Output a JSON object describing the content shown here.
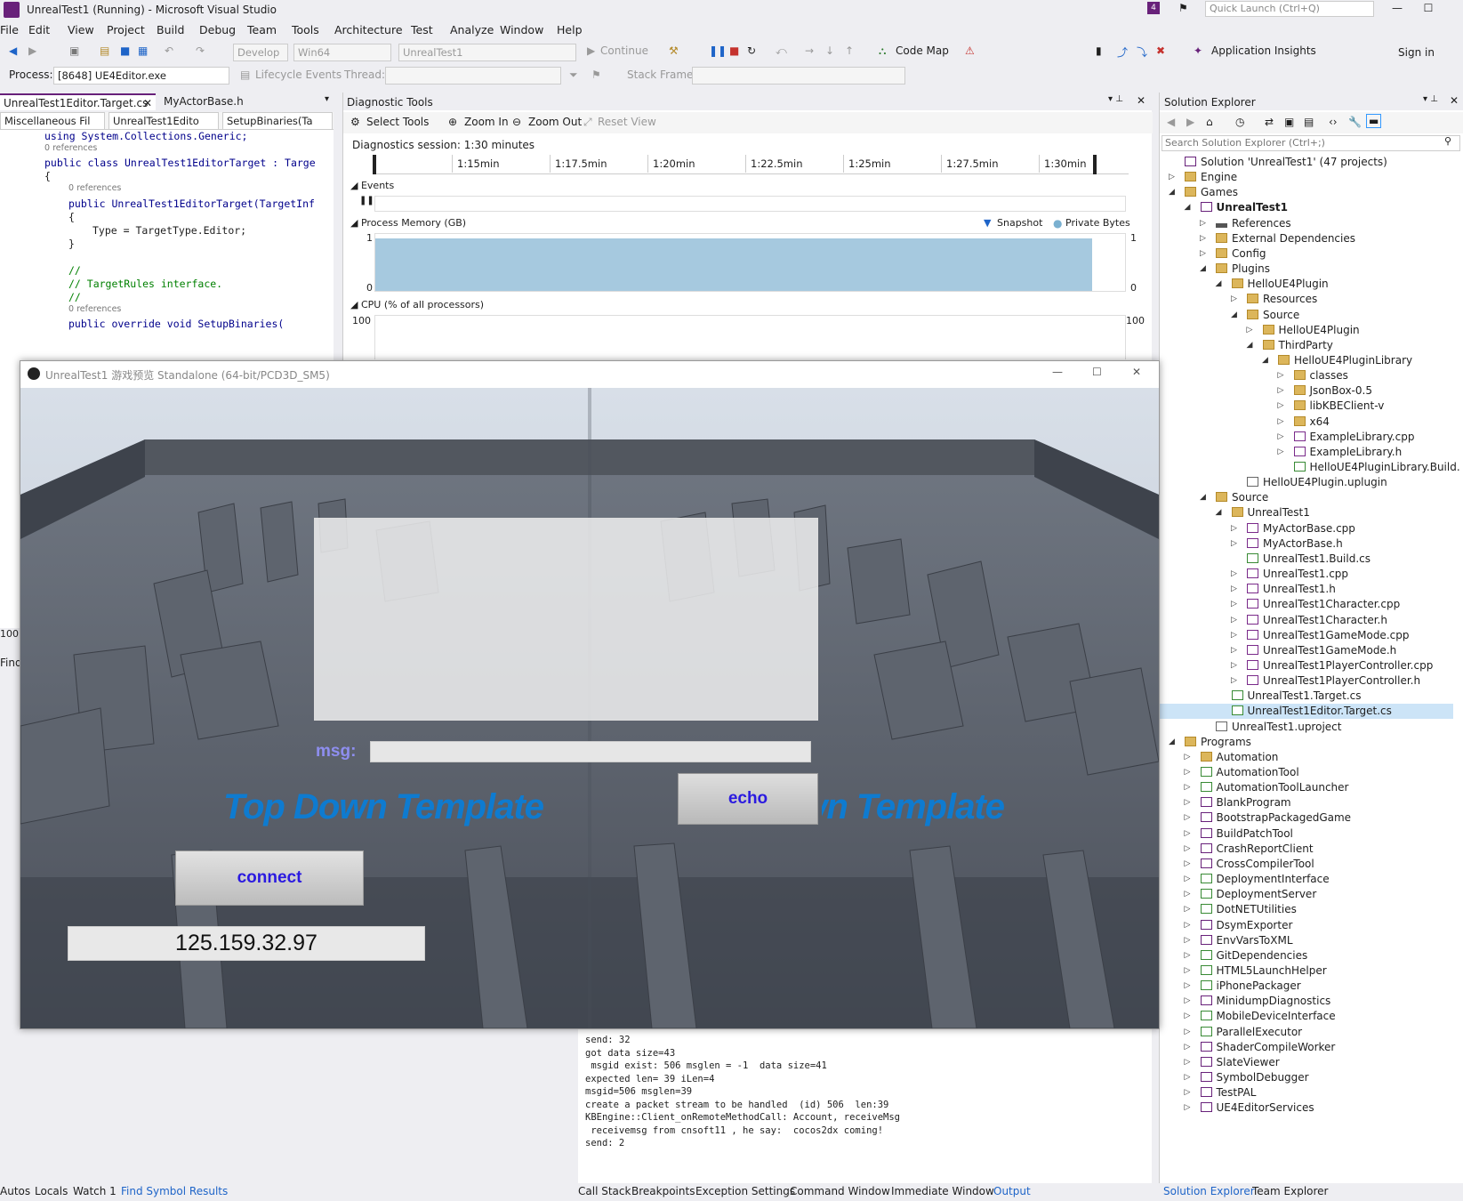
{
  "window": {
    "title": "UnrealTest1 (Running) - Microsoft Visual Studio",
    "quick_launch": "Quick Launch (Ctrl+Q)",
    "notif_count": "4",
    "sign_in": "Sign in"
  },
  "menu": [
    "File",
    "Edit",
    "View",
    "Project",
    "Build",
    "Debug",
    "Team",
    "Tools",
    "Architecture",
    "Test",
    "Analyze",
    "Window",
    "Help"
  ],
  "toolbar": {
    "config": "Develop",
    "platform": "Win64",
    "target": "UnrealTest1",
    "continue": "Continue",
    "code_map": "Code Map",
    "app_insights": "Application Insights"
  },
  "toolbar2": {
    "process_label": "Process:",
    "process_value": "[8648] UE4Editor.exe",
    "lifecycle": "Lifecycle Events",
    "thread_label": "Thread:",
    "stack_frame_label": "Stack Frame:"
  },
  "editor": {
    "tabs": [
      "UnrealTest1Editor.Target.cs",
      "MyActorBase.h"
    ],
    "nav": [
      "Miscellaneous Fil",
      "UnrealTest1Edito",
      "SetupBinaries(Ta"
    ],
    "lines": [
      {
        "indent": 0,
        "text": "using System.Collections.Generic;"
      },
      {
        "indent": 0,
        "text": "0 references",
        "ref": true
      },
      {
        "indent": 0,
        "text": "public class UnrealTest1EditorTarget : Targe"
      },
      {
        "indent": 0,
        "text": "{"
      },
      {
        "indent": 1,
        "text": "0 references",
        "ref": true
      },
      {
        "indent": 1,
        "text": "public UnrealTest1EditorTarget(TargetInf"
      },
      {
        "indent": 1,
        "text": "{"
      },
      {
        "indent": 2,
        "text": "Type = TargetType.Editor;"
      },
      {
        "indent": 1,
        "text": "}"
      },
      {
        "indent": 0,
        "text": ""
      },
      {
        "indent": 1,
        "text": "//"
      },
      {
        "indent": 1,
        "text": "// TargetRules interface."
      },
      {
        "indent": 1,
        "text": "//"
      },
      {
        "indent": 1,
        "text": "0 references",
        "ref": true
      },
      {
        "indent": 1,
        "text": "public override void SetupBinaries("
      }
    ],
    "zoom": "100 %",
    "find": "Find"
  },
  "diag": {
    "title": "Diagnostic Tools",
    "select_tools": "Select Tools",
    "zoom_in": "Zoom In",
    "zoom_out": "Zoom Out",
    "reset_view": "Reset View",
    "session": "Diagnostics session: 1:30 minutes",
    "ticks": [
      "1:15min",
      "1:17.5min",
      "1:20min",
      "1:22.5min",
      "1:25min",
      "1:27.5min",
      "1:30min"
    ],
    "events": "Events",
    "memory": "Process Memory (GB)",
    "snapshot": "Snapshot",
    "private_bytes": "Private Bytes",
    "mem_max": "1",
    "mem_min": "0",
    "cpu": "CPU (% of all processors)",
    "cpu_max": "100",
    "memory_fill": 0.9,
    "colors": {
      "memory": "#a6c9df"
    }
  },
  "game": {
    "title": "UnrealTest1 游戏预览 Standalone (64-bit/PCD3D_SM5)",
    "msg_label": "msg:",
    "msg_value": "",
    "echo": "echo",
    "template_text": "Top Down Template",
    "connect": "connect",
    "ip": "125.159.32.97"
  },
  "output": {
    "lines": [
      "send: 32",
      "got data size=43",
      " msgid exist: 506 msglen = -1  data size=41",
      "expected len= 39 iLen=4",
      "msgid=506 msglen=39",
      "create a packet stream to be handled  (id) 506  len:39",
      "KBEngine::Client_onRemoteMethodCall: Account, receiveMsg",
      " receivemsg from cnsoft11 , he say:  cocos2dx coming!",
      "send: 2"
    ]
  },
  "solution": {
    "title": "Solution Explorer",
    "search": "Search Solution Explorer (Ctrl+;)",
    "items": [
      {
        "d": 0,
        "t": "Solution 'UnrealTest1' (47 projects)",
        "ic": "proj",
        "x": ""
      },
      {
        "d": 0,
        "t": "Engine",
        "ic": "folder",
        "x": "r"
      },
      {
        "d": 0,
        "t": "Games",
        "ic": "folder",
        "x": "d"
      },
      {
        "d": 1,
        "t": "UnrealTest1",
        "ic": "proj",
        "x": "d",
        "b": true
      },
      {
        "d": 2,
        "t": "References",
        "ic": "ref",
        "x": "r"
      },
      {
        "d": 2,
        "t": "External Dependencies",
        "ic": "folder",
        "x": "r"
      },
      {
        "d": 2,
        "t": "Config",
        "ic": "folder",
        "x": "r"
      },
      {
        "d": 2,
        "t": "Plugins",
        "ic": "folder",
        "x": "d"
      },
      {
        "d": 3,
        "t": "HelloUE4Plugin",
        "ic": "folder",
        "x": "d"
      },
      {
        "d": 4,
        "t": "Resources",
        "ic": "folder",
        "x": "r"
      },
      {
        "d": 4,
        "t": "Source",
        "ic": "folder",
        "x": "d"
      },
      {
        "d": 5,
        "t": "HelloUE4Plugin",
        "ic": "folder",
        "x": "r"
      },
      {
        "d": 5,
        "t": "ThirdParty",
        "ic": "folder",
        "x": "d"
      },
      {
        "d": 6,
        "t": "HelloUE4PluginLibrary",
        "ic": "folder",
        "x": "d"
      },
      {
        "d": 7,
        "t": "classes",
        "ic": "folder",
        "x": "r"
      },
      {
        "d": 7,
        "t": "JsonBox-0.5",
        "ic": "folder",
        "x": "r"
      },
      {
        "d": 7,
        "t": "libKBEClient-v",
        "ic": "folder",
        "x": "r"
      },
      {
        "d": 7,
        "t": "x64",
        "ic": "folder",
        "x": "r"
      },
      {
        "d": 7,
        "t": "ExampleLibrary.cpp",
        "ic": "cpp",
        "x": "r"
      },
      {
        "d": 7,
        "t": "ExampleLibrary.h",
        "ic": "cpp",
        "x": "r"
      },
      {
        "d": 7,
        "t": "HelloUE4PluginLibrary.Build.",
        "ic": "csic",
        "x": ""
      },
      {
        "d": 4,
        "t": "HelloUE4Plugin.uplugin",
        "ic": "file",
        "x": ""
      },
      {
        "d": 2,
        "t": "Source",
        "ic": "folder",
        "x": "d"
      },
      {
        "d": 3,
        "t": "UnrealTest1",
        "ic": "folder",
        "x": "d"
      },
      {
        "d": 4,
        "t": "MyActorBase.cpp",
        "ic": "cpp",
        "x": "r"
      },
      {
        "d": 4,
        "t": "MyActorBase.h",
        "ic": "cpp",
        "x": "r"
      },
      {
        "d": 4,
        "t": "UnrealTest1.Build.cs",
        "ic": "csic",
        "x": ""
      },
      {
        "d": 4,
        "t": "UnrealTest1.cpp",
        "ic": "cpp",
        "x": "r"
      },
      {
        "d": 4,
        "t": "UnrealTest1.h",
        "ic": "cpp",
        "x": "r"
      },
      {
        "d": 4,
        "t": "UnrealTest1Character.cpp",
        "ic": "cpp",
        "x": "r"
      },
      {
        "d": 4,
        "t": "UnrealTest1Character.h",
        "ic": "cpp",
        "x": "r"
      },
      {
        "d": 4,
        "t": "UnrealTest1GameMode.cpp",
        "ic": "cpp",
        "x": "r"
      },
      {
        "d": 4,
        "t": "UnrealTest1GameMode.h",
        "ic": "cpp",
        "x": "r"
      },
      {
        "d": 4,
        "t": "UnrealTest1PlayerController.cpp",
        "ic": "cpp",
        "x": "r"
      },
      {
        "d": 4,
        "t": "UnrealTest1PlayerController.h",
        "ic": "cpp",
        "x": "r"
      },
      {
        "d": 3,
        "t": "UnrealTest1.Target.cs",
        "ic": "csic",
        "x": ""
      },
      {
        "d": 3,
        "t": "UnrealTest1Editor.Target.cs",
        "ic": "csic",
        "x": "",
        "sel": true
      },
      {
        "d": 2,
        "t": "UnrealTest1.uproject",
        "ic": "file",
        "x": ""
      },
      {
        "d": 0,
        "t": "Programs",
        "ic": "folder",
        "x": "d"
      },
      {
        "d": 1,
        "t": "Automation",
        "ic": "folder",
        "x": "r"
      },
      {
        "d": 1,
        "t": "AutomationTool",
        "ic": "csic",
        "x": "r"
      },
      {
        "d": 1,
        "t": "AutomationToolLauncher",
        "ic": "csic",
        "x": "r"
      },
      {
        "d": 1,
        "t": "BlankProgram",
        "ic": "proj",
        "x": "r"
      },
      {
        "d": 1,
        "t": "BootstrapPackagedGame",
        "ic": "proj",
        "x": "r"
      },
      {
        "d": 1,
        "t": "BuildPatchTool",
        "ic": "proj",
        "x": "r"
      },
      {
        "d": 1,
        "t": "CrashReportClient",
        "ic": "proj",
        "x": "r"
      },
      {
        "d": 1,
        "t": "CrossCompilerTool",
        "ic": "proj",
        "x": "r"
      },
      {
        "d": 1,
        "t": "DeploymentInterface",
        "ic": "csic",
        "x": "r"
      },
      {
        "d": 1,
        "t": "DeploymentServer",
        "ic": "csic",
        "x": "r"
      },
      {
        "d": 1,
        "t": "DotNETUtilities",
        "ic": "csic",
        "x": "r"
      },
      {
        "d": 1,
        "t": "DsymExporter",
        "ic": "proj",
        "x": "r"
      },
      {
        "d": 1,
        "t": "EnvVarsToXML",
        "ic": "proj",
        "x": "r"
      },
      {
        "d": 1,
        "t": "GitDependencies",
        "ic": "csic",
        "x": "r"
      },
      {
        "d": 1,
        "t": "HTML5LaunchHelper",
        "ic": "csic",
        "x": "r"
      },
      {
        "d": 1,
        "t": "iPhonePackager",
        "ic": "csic",
        "x": "r"
      },
      {
        "d": 1,
        "t": "MinidumpDiagnostics",
        "ic": "proj",
        "x": "r"
      },
      {
        "d": 1,
        "t": "MobileDeviceInterface",
        "ic": "csic",
        "x": "r"
      },
      {
        "d": 1,
        "t": "ParallelExecutor",
        "ic": "csic",
        "x": "r"
      },
      {
        "d": 1,
        "t": "ShaderCompileWorker",
        "ic": "proj",
        "x": "r"
      },
      {
        "d": 1,
        "t": "SlateViewer",
        "ic": "proj",
        "x": "r"
      },
      {
        "d": 1,
        "t": "SymbolDebugger",
        "ic": "proj",
        "x": "r"
      },
      {
        "d": 1,
        "t": "TestPAL",
        "ic": "proj",
        "x": "r"
      },
      {
        "d": 1,
        "t": "UE4EditorServices",
        "ic": "proj",
        "x": "r"
      }
    ]
  },
  "bottom_left": [
    "Autos",
    "Locals",
    "Watch 1",
    "Find Symbol Results"
  ],
  "bottom_mid": [
    "Call Stack",
    "Breakpoints",
    "Exception Settings",
    "Command Window",
    "Immediate Window",
    "Output"
  ],
  "bottom_right": [
    "Solution Explorer",
    "Team Explorer"
  ]
}
